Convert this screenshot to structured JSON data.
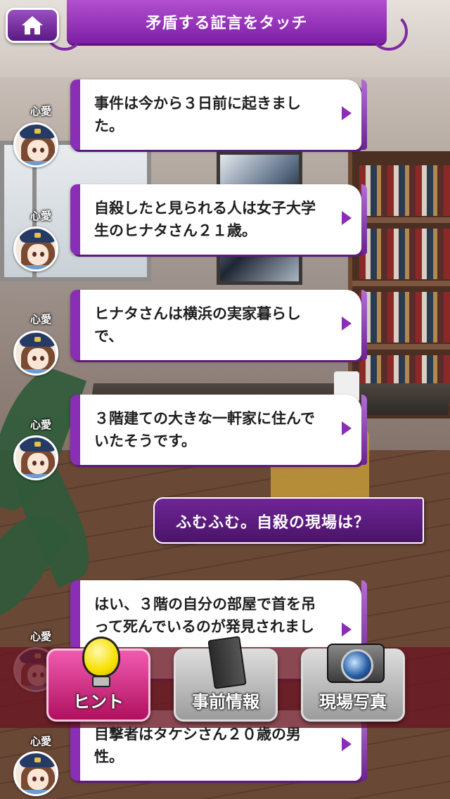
{
  "header": {
    "title": "矛盾する証言をタッチ",
    "home_icon": "home-icon"
  },
  "messages": [
    {
      "speaker": "心愛",
      "text": "事件は今から３日前に起きました。"
    },
    {
      "speaker": "心愛",
      "text": "自殺したと見られる人は女子大学生のヒナタさん２１歳。"
    },
    {
      "speaker": "心愛",
      "text": "ヒナタさんは横浜の実家暮らしで、"
    },
    {
      "speaker": "心愛",
      "text": "３階建ての大きな一軒家に住んでいたそうです。"
    },
    {
      "speaker": "心愛",
      "text": "はい、３階の自分の部屋で首を吊って死んでいるのが発見されました。"
    },
    {
      "speaker": "心愛",
      "text": "目撃者はタケシさん２０歳の男性。"
    }
  ],
  "player_reply": {
    "text": "ふむふむ。自殺の現場は？"
  },
  "menu": {
    "hint_label": "ヒント",
    "info_label": "事前情報",
    "photo_label": "現場写真"
  },
  "colors": {
    "accent": "#8a2fb5",
    "hint_button": "#e0358f",
    "menu_bar": "#691423"
  }
}
